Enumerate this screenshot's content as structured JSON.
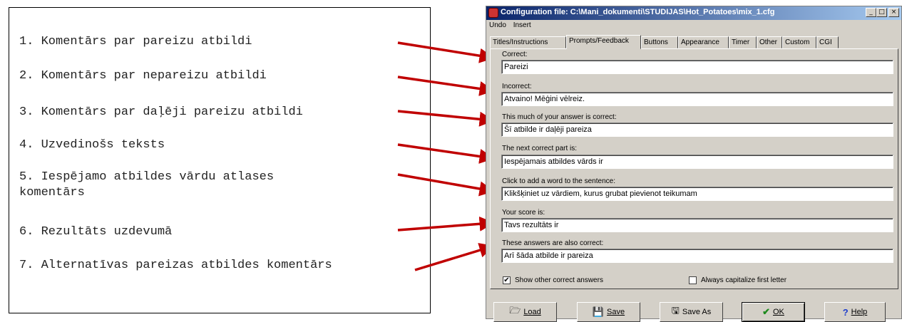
{
  "notes": [
    "1. Komentārs par pareizu atbildi",
    "2. Komentārs par nepareizu atbildi",
    "3. Komentārs par daļēji pareizu atbildi",
    "4. Uzvedinošs teksts",
    "5. Iespējamo atbildes vārdu atlases\nkomentārs",
    "6. Rezultāts uzdevumā",
    "7. Alternatīvas pareizas atbildes komentārs"
  ],
  "window": {
    "title": "Configuration file: C:\\Mani_dokumenti\\STUDIJAS\\Hot_Potatoes\\mix_1.cfg",
    "controls": {
      "minimize": "_",
      "maximize": "□",
      "close": "×"
    }
  },
  "menu": [
    "Undo",
    "Insert"
  ],
  "tabs": [
    "Titles/Instructions",
    "Prompts/Feedback",
    "Buttons",
    "Appearance",
    "Timer",
    "Other",
    "Custom",
    "CGI"
  ],
  "active_tab": "Prompts/Feedback",
  "fields": [
    {
      "label": "Correct:",
      "value": "Pareizi"
    },
    {
      "label": "Incorrect:",
      "value": "Atvaino! Mēģini vēlreiz."
    },
    {
      "label": "This much of your answer is correct:",
      "value": "Šī atbilde ir daļēji pareiza"
    },
    {
      "label": "The next correct part is:",
      "value": "Iespējamais atbildes vārds ir"
    },
    {
      "label": "Click to add a word to the sentence:",
      "value": "Klikšķiniet uz vārdiem, kurus grubat pievienot teikumam"
    },
    {
      "label": "Your score is:",
      "value": "Tavs rezultāts ir"
    },
    {
      "label": "These answers are also correct:",
      "value": "Arī šāda atbilde ir pareiza"
    }
  ],
  "checkboxes": {
    "show_other": {
      "label": "Show other correct answers",
      "checked": true,
      "mark": "✔"
    },
    "capitalize": {
      "label": "Always capitalize first letter",
      "checked": false,
      "mark": ""
    }
  },
  "buttons": {
    "load": {
      "label": "Load",
      "icon": "folder-icon",
      "glyph": "🗁"
    },
    "save": {
      "label": "Save",
      "icon": "floppy-icon",
      "glyph": "💾"
    },
    "save_as": {
      "label": "Save As",
      "icon": "floppy-as-icon",
      "glyph": "🖫"
    },
    "ok": {
      "label": "OK",
      "icon": "checkmark-icon",
      "glyph": "✔"
    },
    "help": {
      "label": "Help",
      "icon": "question-icon",
      "glyph": "?"
    }
  },
  "colors": {
    "arrow": "#c00000",
    "titlebar_start": "#0a246a",
    "titlebar_end": "#a6caf0",
    "ok_check": "#1e8a1e",
    "help_q": "#1c3ccc"
  }
}
